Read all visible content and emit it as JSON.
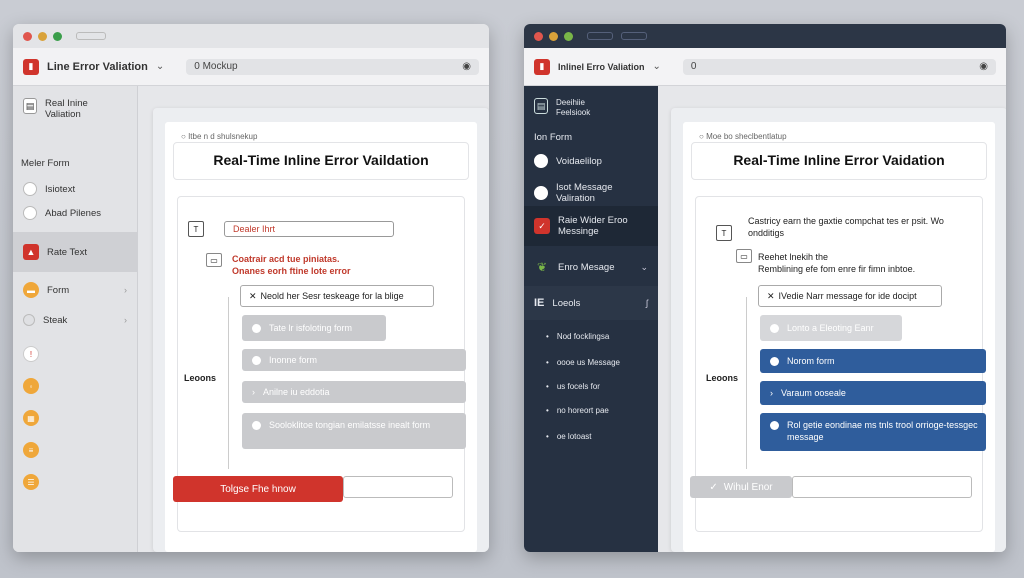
{
  "left": {
    "app_title": "Line Error Valiation",
    "url": "0 Mockup",
    "sidebar": {
      "items": [
        {
          "label": "Real Inine Valiation"
        },
        {
          "label": "Meler Form"
        },
        {
          "label": "Isiotext"
        },
        {
          "label": "Abad Pilenes"
        },
        {
          "label": "Rate Text"
        },
        {
          "label": "Form"
        },
        {
          "label": "Steak"
        }
      ]
    },
    "doc": {
      "crumb": "Itbe n d shulsnekup",
      "title": "Real-Time Inline Error Vaildation",
      "field_label": "Dealer Ihrt",
      "error_lines": [
        "Coatrair acd tue piniatas.",
        "Onanes eorh ftine lote error"
      ],
      "inline_input": "Neold her Sesr teskeage for la blige",
      "options": [
        "Tate lr isfoloting form",
        "Inonne form",
        "Anilne iu eddotia",
        "Sooloklitoe tongian emilatsse inealt form"
      ],
      "side_label": "Leoons",
      "bottom_button": "Tolgse Fhe hnow"
    }
  },
  "right": {
    "app_title": "Inlinel Erro Valiation",
    "url": "0",
    "sidebar": {
      "items": [
        {
          "label": "Deeihiie Feelsiook"
        },
        {
          "label": "Ion Form"
        },
        {
          "label": "Voidaelilop"
        },
        {
          "label": "Isot Message Valiration"
        },
        {
          "label": "Raie Wider Eroo Messinge"
        },
        {
          "label": "Enro Mesage"
        },
        {
          "label": "Loeols"
        }
      ],
      "bullets": [
        "Nod focklingsa",
        "oooe us Message",
        "us focels for",
        "no horeort pae",
        "oe lotoast"
      ]
    },
    "doc": {
      "crumb": "Moe bo sheclbentlatup",
      "title": "Real-Time Inline Error Vaidation",
      "error_lines": [
        "Castricy earn the gaxtie compchat tes er psit. Wo",
        "ondditigs"
      ],
      "sub_lines": [
        "Reehet lnekih the",
        "Remblining efe fom enre fir fimn inbtoe."
      ],
      "inline_input": "IVedie Narr message for ide docipt",
      "options": [
        "Lonto a Eleoting Eanr",
        "Norom form",
        "Varaum ooseale",
        "Rol getie eondinae ms tnls trool orrioge-tessgec message"
      ],
      "side_label": "Leoons",
      "bottom_button": "Wihul Enor"
    }
  },
  "colors": {
    "red": "#d0342c",
    "blue": "#2f5d9c",
    "grey_option": "#c9cacd",
    "dark_sidebar": "#263142"
  }
}
